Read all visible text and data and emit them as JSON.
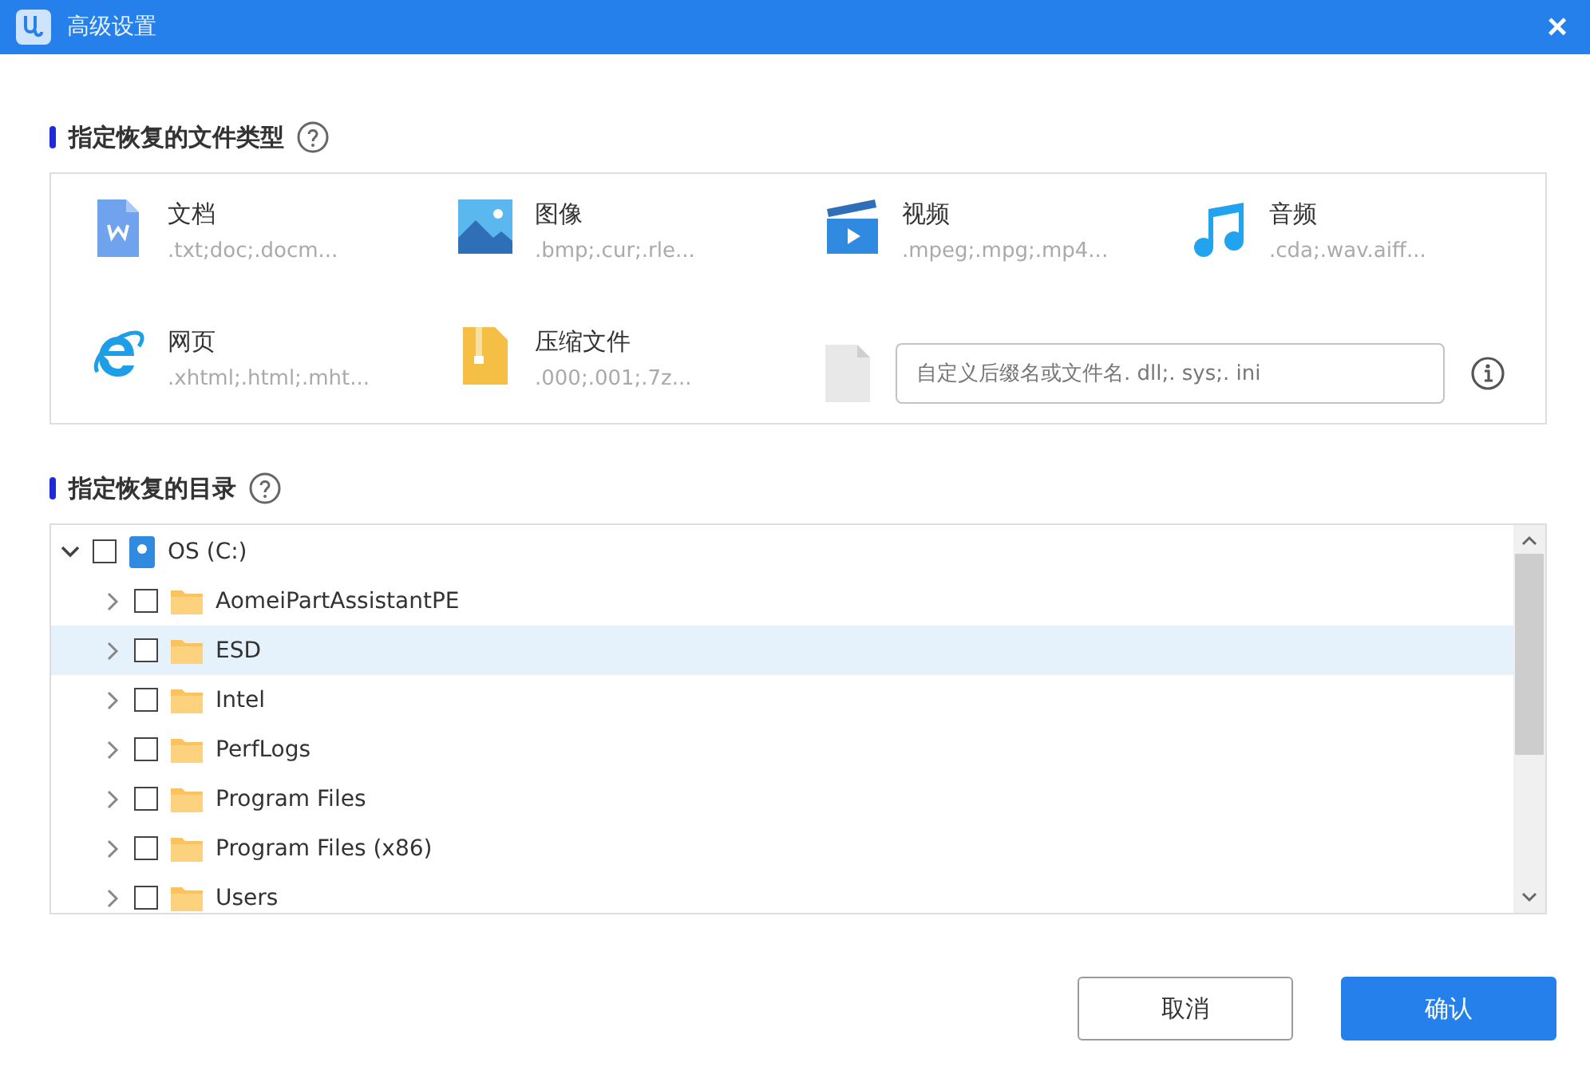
{
  "window": {
    "title": "高级设置",
    "close": "×"
  },
  "file_types": {
    "heading": "指定恢复的文件类型",
    "items": [
      {
        "kind": "document",
        "name": "文档",
        "extensions": ".txt;doc;.docm..."
      },
      {
        "kind": "image",
        "name": "图像",
        "extensions": ".bmp;.cur;.rle..."
      },
      {
        "kind": "video",
        "name": "视频",
        "extensions": ".mpeg;.mpg;.mp4..."
      },
      {
        "kind": "audio",
        "name": "音频",
        "extensions": ".cda;.wav.aiff..."
      },
      {
        "kind": "web",
        "name": "网页",
        "extensions": ".xhtml;.html;.mht..."
      },
      {
        "kind": "archive",
        "name": "压缩文件",
        "extensions": ".000;.001;.7z..."
      }
    ],
    "custom": {
      "placeholder": "自定义后缀名或文件名. dll;. sys;. ini"
    }
  },
  "directory": {
    "heading": "指定恢复的目录",
    "tree": [
      {
        "kind": "drive",
        "label": "OS (C:)",
        "expanded": true,
        "checked": false,
        "selected": false,
        "children": [
          {
            "kind": "folder",
            "label": "AomeiPartAssistantPE",
            "expanded": false,
            "checked": false,
            "selected": false
          },
          {
            "kind": "folder",
            "label": "ESD",
            "expanded": false,
            "checked": false,
            "selected": true
          },
          {
            "kind": "folder",
            "label": "Intel",
            "expanded": false,
            "checked": false,
            "selected": false
          },
          {
            "kind": "folder",
            "label": "PerfLogs",
            "expanded": false,
            "checked": false,
            "selected": false
          },
          {
            "kind": "folder",
            "label": "Program Files",
            "expanded": false,
            "checked": false,
            "selected": false
          },
          {
            "kind": "folder",
            "label": "Program Files (x86)",
            "expanded": false,
            "checked": false,
            "selected": false
          },
          {
            "kind": "folder",
            "label": "Users",
            "expanded": false,
            "checked": false,
            "selected": false
          }
        ]
      }
    ]
  },
  "buttons": [
    {
      "kind": "secondary",
      "label": "取消"
    },
    {
      "kind": "primary",
      "label": "确认"
    }
  ]
}
